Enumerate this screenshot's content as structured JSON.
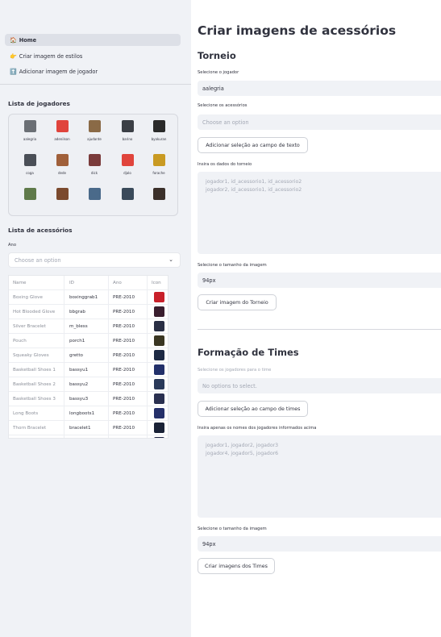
{
  "nav": [
    {
      "icon": "🏠",
      "label": "Home"
    },
    {
      "icon": "👉",
      "label": "Criar imagem de estilos"
    },
    {
      "icon": "⬆️",
      "label": "Adicionar imagem de jogador"
    }
  ],
  "sidebar": {
    "players_header": "Lista de jogadores",
    "players": [
      {
        "name": "aalegria",
        "color": "#6b6f75"
      },
      {
        "name": "adenilson",
        "color": "#e0443c"
      },
      {
        "name": "ajudante",
        "color": "#8a6a46"
      },
      {
        "name": "barino",
        "color": "#3b3f45"
      },
      {
        "name": "byakuran",
        "color": "#2a2a2a"
      },
      {
        "name": "coga",
        "color": "#4a4f57"
      },
      {
        "name": "dede",
        "color": "#a0603a"
      },
      {
        "name": "dick",
        "color": "#7a3b3b"
      },
      {
        "name": "djalo",
        "color": "#e0443c"
      },
      {
        "name": "forache",
        "color": "#c99a22"
      },
      {
        "name": "",
        "color": "#5f7a4a"
      },
      {
        "name": "",
        "color": "#7b4a2e"
      },
      {
        "name": "",
        "color": "#4a6a8a"
      },
      {
        "name": "",
        "color": "#3a4a5a"
      },
      {
        "name": "",
        "color": "#3b302a"
      }
    ],
    "accessories_header": "Lista de acessórios",
    "ano_label": "Ano",
    "ano_placeholder": "Choose an option",
    "table": {
      "columns": [
        "Name",
        "ID",
        "Ano",
        "Icon"
      ],
      "rows": [
        {
          "name": "Boxing Glove",
          "id": "boxinggrab1",
          "ano": "PRE-2010",
          "icon_color": "#c8202a"
        },
        {
          "name": "Hot Blooded Glove",
          "id": "bbgrab",
          "ano": "PRE-2010",
          "icon_color": "#3a1e2e"
        },
        {
          "name": "Silver Bracelet",
          "id": "m_bless",
          "ano": "PRE-2010",
          "icon_color": "#2a2f44"
        },
        {
          "name": "Pouch",
          "id": "porch1",
          "ano": "PRE-2010",
          "icon_color": "#3a3622"
        },
        {
          "name": "Squeaky Gloves",
          "id": "gretto",
          "ano": "PRE-2010",
          "icon_color": "#1e2a44"
        },
        {
          "name": "Basketball Shoes 1",
          "id": "bassyu1",
          "ano": "PRE-2010",
          "icon_color": "#22306a"
        },
        {
          "name": "Basketball Shoes 2",
          "id": "bassyu2",
          "ano": "PRE-2010",
          "icon_color": "#2a3a5a"
        },
        {
          "name": "Basketball Shoes 3",
          "id": "bassyu3",
          "ano": "PRE-2010",
          "icon_color": "#2a3050"
        },
        {
          "name": "Long Boots",
          "id": "longboots1",
          "ano": "PRE-2010",
          "icon_color": "#25306a"
        },
        {
          "name": "Thorn Bracelet",
          "id": "bracelet1",
          "ano": "PRE-2010",
          "icon_color": "#1a2236"
        }
      ]
    }
  },
  "main": {
    "title": "Criar imagens de acessórios",
    "torneio": {
      "header": "Torneio",
      "player_label": "Selecione o jogador",
      "player_value": "aalegria",
      "acc_label": "Selecione os acessórios",
      "acc_placeholder": "Choose an option",
      "add_btn": "Adicionar seleção ao campo de texto",
      "data_label": "Insira os dados do torneio",
      "data_placeholder_1": "jogador1, id_acessorio1, id_acessorio2",
      "data_placeholder_2": "jogador2, id_acessorio1, id_acessorio2",
      "size_label": "Selecione o tamanho da imagem",
      "size_value": "94px",
      "create_btn": "Criar imagem do Torneio"
    },
    "times": {
      "header": "Formação de Times",
      "players_label": "Selecione os jogadores para o time",
      "players_placeholder": "No options to select.",
      "add_btn": "Adicionar seleção ao campo de times",
      "names_label": "Insira apenas os nomes dos jogadores informados acima",
      "names_placeholder_1": "jogador1, jogador2, jogador3",
      "names_placeholder_2": "jogador4, jogador5, jogador6",
      "size_label": "Selecione o tamanho da imagem",
      "size_value": "94px",
      "create_btn": "Criar imagens dos Times"
    }
  }
}
